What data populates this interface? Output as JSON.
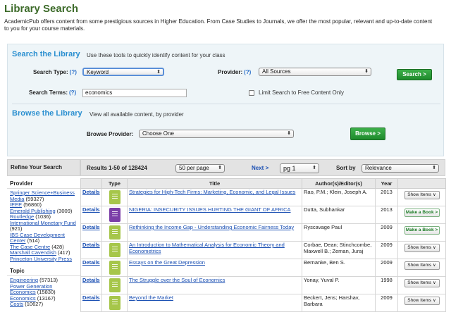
{
  "header": {
    "title": "Library Search",
    "intro": "AcademicPub offers content from some prestigious sources in Higher Education. From Case Studies to Journals, we offer the most popular, relevant and up-to-date content to you for your course materials."
  },
  "search": {
    "section_title": "Search the Library",
    "section_desc": "Use these tools to quickly identify content for your class",
    "type_label": "Search Type:",
    "type_value": "Keyword",
    "provider_label": "Provider:",
    "provider_value": "All Sources",
    "help": "(?)",
    "terms_label": "Search Terms:",
    "terms_value": "economics",
    "limit_label": "Limit Search to Free Content Only",
    "button": "Search >"
  },
  "browse": {
    "section_title": "Browse the Library",
    "section_desc": "View all available content, by provider",
    "provider_label": "Browse Provider:",
    "provider_value": "Choose One",
    "button": "Browse >"
  },
  "sidebar": {
    "refine": "Refine Your Search",
    "provider_heading": "Provider",
    "providers": [
      {
        "name": "Springer Science+Business Media",
        "count": "(59327)"
      },
      {
        "name": "IEEE",
        "count": "(56860)"
      },
      {
        "name": "Emerald Publishing",
        "count": "(3009)"
      },
      {
        "name": "Routledge",
        "count": "(1036)"
      },
      {
        "name": "International Monetary Fund",
        "count": "(921)"
      },
      {
        "name": "IBS Case Development Center",
        "count": "(514)"
      },
      {
        "name": "The Case Centre",
        "count": "(428)"
      },
      {
        "name": "Marshall Cavendish",
        "count": "(417)"
      },
      {
        "name": "Princeton University Press",
        "count": ""
      }
    ],
    "topic_heading": "Topic",
    "topics": [
      {
        "name": "Engineering",
        "count": "(57313)"
      },
      {
        "name": "Power Generation Economics",
        "count": "(15830)"
      },
      {
        "name": "Economics",
        "count": "(13167)"
      },
      {
        "name": "Costs",
        "count": "(10627)"
      }
    ]
  },
  "results": {
    "summary": "Results 1-50 of 128424",
    "per_page": "50 per page",
    "next": "Next >",
    "page": "pg 1",
    "sort_label": "Sort by",
    "sort_value": "Relevance",
    "columns": [
      "Type",
      "Title",
      "Author(s)/Editor(s)",
      "Year"
    ],
    "details_label": "Details",
    "rows": [
      {
        "type_color": "#a6c64a",
        "title": "Strategies for High-Tech Firms: Marketing, Economic, and Legal Issues",
        "authors": "Rao, P.M.; Klein, Joseph A.",
        "year": "2013",
        "action": "Show Items ∨",
        "action_kind": "show"
      },
      {
        "type_color": "#7b3fa8",
        "title": "NIGERIA: INSECURITY ISSUES HURTING THE GIANT OF AFRICA",
        "authors": "Dutta, Subhankar",
        "year": "2013",
        "action": "Make a Book >",
        "action_kind": "book"
      },
      {
        "type_color": "#a6c64a",
        "title": "Rethinking the Income Gap - Understanding Economic Fairness Today",
        "authors": "Ryscavage Paul",
        "year": "2009",
        "action": "Make a Book >",
        "action_kind": "book"
      },
      {
        "type_color": "#a6c64a",
        "title": "An Introduction to Mathematical Analysis for Economic Theory and Econometrics",
        "authors": "Corbae, Dean; Stinchcombe, Maxwell B.; Zeman, Juraj",
        "year": "2009",
        "action": "Show Items ∨",
        "action_kind": "show"
      },
      {
        "type_color": "#a6c64a",
        "title": "Essays on the Great Depression",
        "authors": "Bernanke, Ben S.",
        "year": "2009",
        "action": "Show Items ∨",
        "action_kind": "show"
      },
      {
        "type_color": "#a6c64a",
        "title": "The Struggle over the Soul of Economics",
        "authors": "Yonay, Yuval P.",
        "year": "1998",
        "action": "Show Items ∨",
        "action_kind": "show"
      },
      {
        "type_color": "#a6c64a",
        "title": "Beyond the Market",
        "authors": "Beckert, Jens; Harshav, Barbara",
        "year": "2009",
        "action": "Show Items ∨",
        "action_kind": "show"
      }
    ]
  }
}
